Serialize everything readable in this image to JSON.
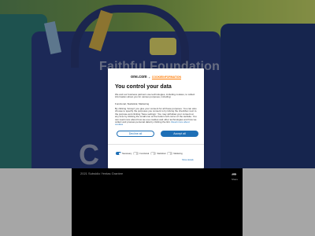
{
  "hero": {
    "title": "Faithful Foundation",
    "big_letter": "C"
  },
  "video": {
    "caption": "2021 Subsidio Yentas Grantee",
    "icon_label": "Share"
  },
  "consent": {
    "logo_main": "one.com",
    "logo_plus": "+",
    "logo_sub": "COOKIEINFORMATION",
    "title": "You control your data",
    "paragraph1": "We and our business partners use technologies, including cookies, to collect information about you for various purposes, including:",
    "purposes": "Functional, Statistical, Marketing",
    "paragraph2": "By clicking 'Accept' you give your consent for all these purposes. You can also choose to specify the purposes you consent to by ticking the checkbox next to the purpose and clicking 'Save settings'. You may withdraw your consent at any time by clicking the small icon at the bottom left corner of the website. You can read more about how we use cookies and other technologies and how we collect and process personal data by clicking the link.",
    "read_more_link": "Read more about cookies",
    "decline_label": "Decline all",
    "accept_label": "Accept all",
    "toggles": [
      {
        "label": "Necessary",
        "on": true
      },
      {
        "label": "Functional",
        "on": false
      },
      {
        "label": "Statistical",
        "on": false
      },
      {
        "label": "Marketing",
        "on": false
      }
    ],
    "show_details": "Show details"
  },
  "colors": {
    "accent": "#1e6fb6",
    "logo_orange": "#ff7a00"
  }
}
